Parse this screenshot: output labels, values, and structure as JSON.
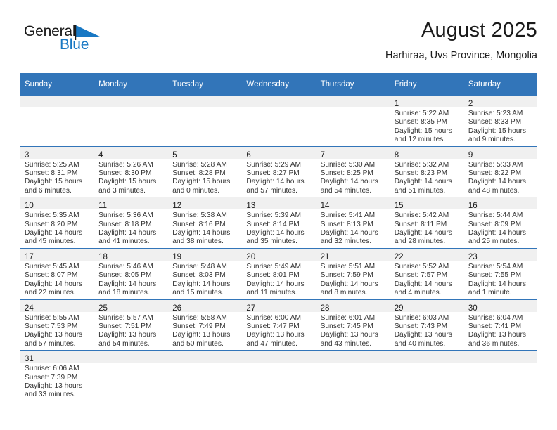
{
  "brand": {
    "name_part1": "General",
    "name_part2": "Blue",
    "flag_icon": "blue-triangle-flag-icon",
    "flag_color": "#1878c4"
  },
  "header": {
    "title": "August 2025",
    "subtitle": "Harhiraa, Uvs Province, Mongolia"
  },
  "theme": {
    "header_bar": "#3275b9",
    "daynum_band": "#f0f0f0",
    "text": "#333333",
    "accent": "#1878c4"
  },
  "weekday_headers": [
    "Sunday",
    "Monday",
    "Tuesday",
    "Wednesday",
    "Thursday",
    "Friday",
    "Saturday"
  ],
  "weeks": [
    [
      {
        "day": "",
        "lines": []
      },
      {
        "day": "",
        "lines": []
      },
      {
        "day": "",
        "lines": []
      },
      {
        "day": "",
        "lines": []
      },
      {
        "day": "",
        "lines": []
      },
      {
        "day": "1",
        "lines": [
          "Sunrise: 5:22 AM",
          "Sunset: 8:35 PM",
          "Daylight: 15 hours",
          "and 12 minutes."
        ]
      },
      {
        "day": "2",
        "lines": [
          "Sunrise: 5:23 AM",
          "Sunset: 8:33 PM",
          "Daylight: 15 hours",
          "and 9 minutes."
        ]
      }
    ],
    [
      {
        "day": "3",
        "lines": [
          "Sunrise: 5:25 AM",
          "Sunset: 8:31 PM",
          "Daylight: 15 hours",
          "and 6 minutes."
        ]
      },
      {
        "day": "4",
        "lines": [
          "Sunrise: 5:26 AM",
          "Sunset: 8:30 PM",
          "Daylight: 15 hours",
          "and 3 minutes."
        ]
      },
      {
        "day": "5",
        "lines": [
          "Sunrise: 5:28 AM",
          "Sunset: 8:28 PM",
          "Daylight: 15 hours",
          "and 0 minutes."
        ]
      },
      {
        "day": "6",
        "lines": [
          "Sunrise: 5:29 AM",
          "Sunset: 8:27 PM",
          "Daylight: 14 hours",
          "and 57 minutes."
        ]
      },
      {
        "day": "7",
        "lines": [
          "Sunrise: 5:30 AM",
          "Sunset: 8:25 PM",
          "Daylight: 14 hours",
          "and 54 minutes."
        ]
      },
      {
        "day": "8",
        "lines": [
          "Sunrise: 5:32 AM",
          "Sunset: 8:23 PM",
          "Daylight: 14 hours",
          "and 51 minutes."
        ]
      },
      {
        "day": "9",
        "lines": [
          "Sunrise: 5:33 AM",
          "Sunset: 8:22 PM",
          "Daylight: 14 hours",
          "and 48 minutes."
        ]
      }
    ],
    [
      {
        "day": "10",
        "lines": [
          "Sunrise: 5:35 AM",
          "Sunset: 8:20 PM",
          "Daylight: 14 hours",
          "and 45 minutes."
        ]
      },
      {
        "day": "11",
        "lines": [
          "Sunrise: 5:36 AM",
          "Sunset: 8:18 PM",
          "Daylight: 14 hours",
          "and 41 minutes."
        ]
      },
      {
        "day": "12",
        "lines": [
          "Sunrise: 5:38 AM",
          "Sunset: 8:16 PM",
          "Daylight: 14 hours",
          "and 38 minutes."
        ]
      },
      {
        "day": "13",
        "lines": [
          "Sunrise: 5:39 AM",
          "Sunset: 8:14 PM",
          "Daylight: 14 hours",
          "and 35 minutes."
        ]
      },
      {
        "day": "14",
        "lines": [
          "Sunrise: 5:41 AM",
          "Sunset: 8:13 PM",
          "Daylight: 14 hours",
          "and 32 minutes."
        ]
      },
      {
        "day": "15",
        "lines": [
          "Sunrise: 5:42 AM",
          "Sunset: 8:11 PM",
          "Daylight: 14 hours",
          "and 28 minutes."
        ]
      },
      {
        "day": "16",
        "lines": [
          "Sunrise: 5:44 AM",
          "Sunset: 8:09 PM",
          "Daylight: 14 hours",
          "and 25 minutes."
        ]
      }
    ],
    [
      {
        "day": "17",
        "lines": [
          "Sunrise: 5:45 AM",
          "Sunset: 8:07 PM",
          "Daylight: 14 hours",
          "and 22 minutes."
        ]
      },
      {
        "day": "18",
        "lines": [
          "Sunrise: 5:46 AM",
          "Sunset: 8:05 PM",
          "Daylight: 14 hours",
          "and 18 minutes."
        ]
      },
      {
        "day": "19",
        "lines": [
          "Sunrise: 5:48 AM",
          "Sunset: 8:03 PM",
          "Daylight: 14 hours",
          "and 15 minutes."
        ]
      },
      {
        "day": "20",
        "lines": [
          "Sunrise: 5:49 AM",
          "Sunset: 8:01 PM",
          "Daylight: 14 hours",
          "and 11 minutes."
        ]
      },
      {
        "day": "21",
        "lines": [
          "Sunrise: 5:51 AM",
          "Sunset: 7:59 PM",
          "Daylight: 14 hours",
          "and 8 minutes."
        ]
      },
      {
        "day": "22",
        "lines": [
          "Sunrise: 5:52 AM",
          "Sunset: 7:57 PM",
          "Daylight: 14 hours",
          "and 4 minutes."
        ]
      },
      {
        "day": "23",
        "lines": [
          "Sunrise: 5:54 AM",
          "Sunset: 7:55 PM",
          "Daylight: 14 hours",
          "and 1 minute."
        ]
      }
    ],
    [
      {
        "day": "24",
        "lines": [
          "Sunrise: 5:55 AM",
          "Sunset: 7:53 PM",
          "Daylight: 13 hours",
          "and 57 minutes."
        ]
      },
      {
        "day": "25",
        "lines": [
          "Sunrise: 5:57 AM",
          "Sunset: 7:51 PM",
          "Daylight: 13 hours",
          "and 54 minutes."
        ]
      },
      {
        "day": "26",
        "lines": [
          "Sunrise: 5:58 AM",
          "Sunset: 7:49 PM",
          "Daylight: 13 hours",
          "and 50 minutes."
        ]
      },
      {
        "day": "27",
        "lines": [
          "Sunrise: 6:00 AM",
          "Sunset: 7:47 PM",
          "Daylight: 13 hours",
          "and 47 minutes."
        ]
      },
      {
        "day": "28",
        "lines": [
          "Sunrise: 6:01 AM",
          "Sunset: 7:45 PM",
          "Daylight: 13 hours",
          "and 43 minutes."
        ]
      },
      {
        "day": "29",
        "lines": [
          "Sunrise: 6:03 AM",
          "Sunset: 7:43 PM",
          "Daylight: 13 hours",
          "and 40 minutes."
        ]
      },
      {
        "day": "30",
        "lines": [
          "Sunrise: 6:04 AM",
          "Sunset: 7:41 PM",
          "Daylight: 13 hours",
          "and 36 minutes."
        ]
      }
    ],
    [
      {
        "day": "31",
        "lines": [
          "Sunrise: 6:06 AM",
          "Sunset: 7:39 PM",
          "Daylight: 13 hours",
          "and 33 minutes."
        ]
      },
      {
        "day": "",
        "lines": []
      },
      {
        "day": "",
        "lines": []
      },
      {
        "day": "",
        "lines": []
      },
      {
        "day": "",
        "lines": []
      },
      {
        "day": "",
        "lines": []
      },
      {
        "day": "",
        "lines": []
      }
    ]
  ]
}
